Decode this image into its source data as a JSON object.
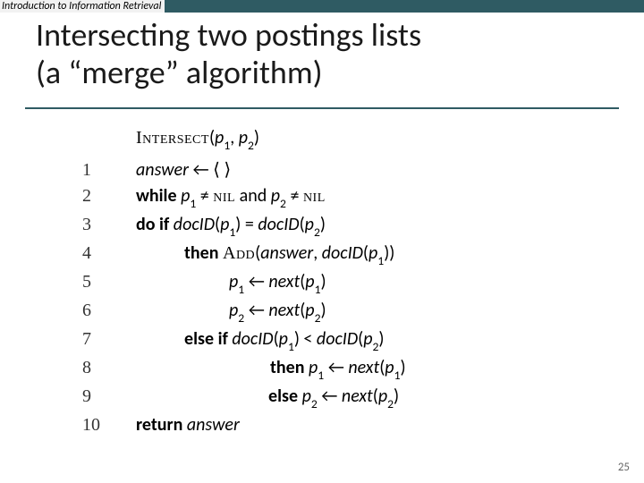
{
  "header": {
    "label": "Introduction to Information Retrieval"
  },
  "title": {
    "line1": "Intersecting two postings lists",
    "line2": "(a “merge” algorithm)"
  },
  "algo_head": {
    "name": "Intersect",
    "args_open": "(",
    "p": "p",
    "sub1": "1",
    "sep": ", ",
    "sub2": "2",
    "args_close": ")"
  },
  "lines": {
    "l1": {
      "no": "1",
      "ans": "answer",
      "arrow": " ← ",
      "empty": "⟨ ⟩"
    },
    "l2": {
      "no": "2",
      "while": "while",
      "sp": "  ",
      "p": "p",
      "sub1": "1",
      "ne": " ≠ ",
      "nil": "nil",
      "and": " and ",
      "sub2": "2"
    },
    "l3": {
      "no": "3",
      "do": "do ",
      "if": "if",
      "sp": "  ",
      "doc": "docID",
      "lp": "(",
      "p": "p",
      "sub1": "1",
      "rp": ")",
      "eq": " = ",
      "sub2": "2"
    },
    "l4": {
      "no": "4",
      "then": "then",
      "sp": "  ",
      "add": "Add",
      "lp": "(",
      "ans": "answer",
      "c": ", ",
      "doc": "docID",
      "p": "p",
      "sub1": "1",
      "rp2": "))"
    },
    "l5": {
      "no": "5",
      "p": "p",
      "sub1": "1",
      "arrow": " ← ",
      "next": "next",
      "lp": "(",
      "rp": ")"
    },
    "l6": {
      "no": "6",
      "p": "p",
      "sub2": "2",
      "arrow": " ← ",
      "next": "next",
      "lp": "(",
      "rp": ")"
    },
    "l7": {
      "no": "7",
      "else": "else",
      "sp": "   ",
      "if": "if",
      "sp2": "   ",
      "doc": "docID",
      "lp": "(",
      "p": "p",
      "sub1": "1",
      "rp": ")",
      "lt": " < ",
      "sub2": "2"
    },
    "l8": {
      "no": "8",
      "then": "then",
      "sp": "  ",
      "p": "p",
      "sub1": "1",
      "arrow": " ← ",
      "next": "next",
      "lp": "(",
      "rp": ")"
    },
    "l9": {
      "no": "9",
      "else": "else",
      "sp": "   ",
      "p": "p",
      "sub2": "2",
      "arrow": " ← ",
      "next": "next",
      "lp": "(",
      "rp": ")"
    },
    "l10": {
      "no": "10",
      "return": "return",
      "sp": "  ",
      "ans": "answer"
    }
  },
  "pagenum": "25"
}
